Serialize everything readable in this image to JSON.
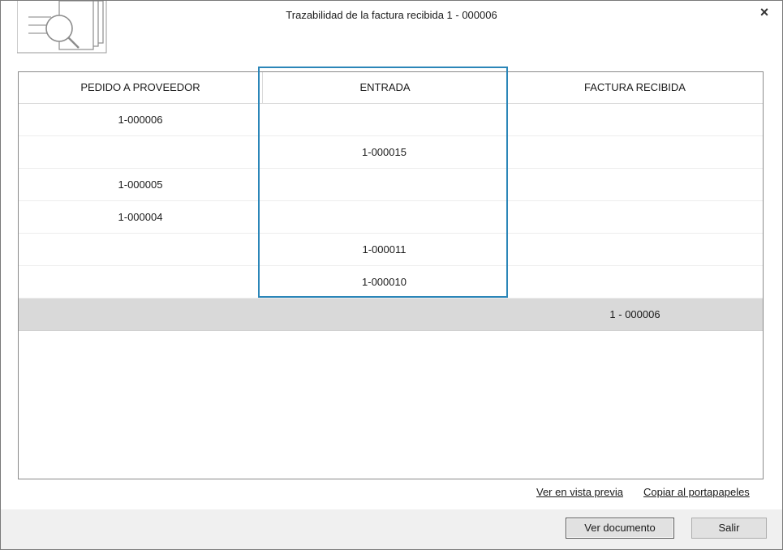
{
  "window": {
    "title": "Trazabilidad de la factura recibida 1 - 000006",
    "close_label": "×"
  },
  "grid": {
    "columns": [
      "PEDIDO A PROVEEDOR",
      "ENTRADA",
      "FACTURA RECIBIDA"
    ],
    "rows": [
      [
        "1-000006",
        "",
        ""
      ],
      [
        "",
        "1-000015",
        ""
      ],
      [
        "1-000005",
        "",
        ""
      ],
      [
        "1-000004",
        "",
        ""
      ],
      [
        "",
        "1-000011",
        ""
      ],
      [
        "",
        "1-000010",
        ""
      ],
      [
        "",
        "",
        "1 - 000006"
      ]
    ],
    "selected_row": 6
  },
  "links": {
    "preview": "Ver en vista previa",
    "copy": "Copiar al portapapeles"
  },
  "buttons": {
    "view_document": "Ver documento",
    "exit": "Salir"
  },
  "colors": {
    "highlight": "#2b86b8",
    "selected_row": "#d9d9d9"
  },
  "icons": {
    "header": "document-search-icon",
    "close": "close-icon"
  }
}
